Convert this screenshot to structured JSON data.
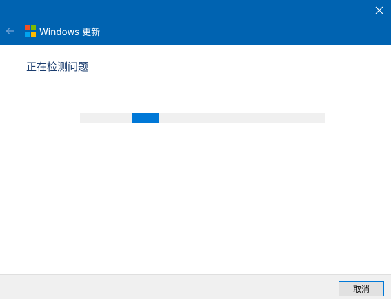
{
  "window": {
    "app_title": "Windows 更新",
    "accent_color": "#0063b1"
  },
  "icons": {
    "close": "close-icon",
    "back": "back-arrow-icon",
    "logo": "windows-logo-icon"
  },
  "main": {
    "heading": "正在检测问题",
    "progress": {
      "type": "indeterminate",
      "chunk_start_fraction": 0.21,
      "chunk_length_fraction": 0.11,
      "fill_color": "#0078d7",
      "track_color": "#f0f0f0"
    }
  },
  "footer": {
    "cancel_label": "取消"
  }
}
